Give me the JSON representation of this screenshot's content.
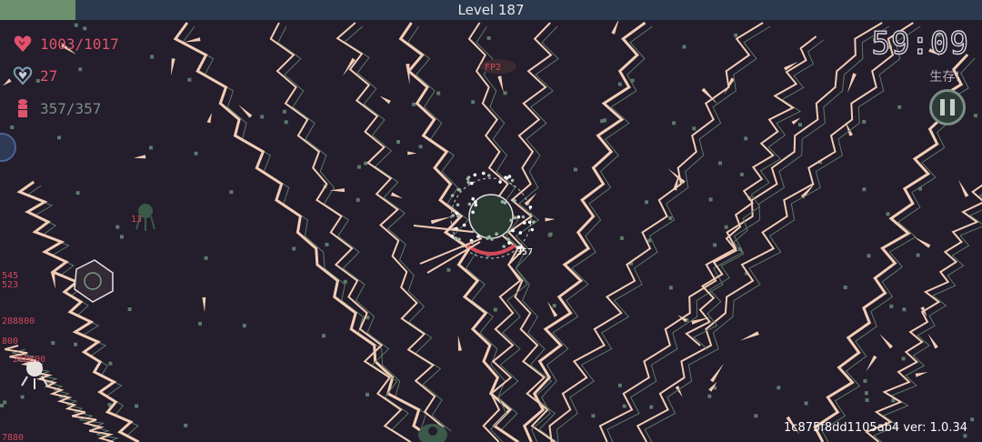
{
  "hud": {
    "level_text": "Level 187",
    "xp_fraction": 0.077,
    "hp_text": "1003/1017",
    "armor_text": "27",
    "ammo_text": "357/357",
    "timer": "59:09",
    "objective": "生存!",
    "version": "1c875f8dd1105ab4 ver: 1.0.34"
  },
  "icons": {
    "hp": "heart-icon",
    "armor": "shield-heart-icon",
    "ammo": "bullet-icon",
    "pause": "pause-icon",
    "ability": "ability-orb-icon"
  },
  "colors": {
    "background": "#231d2c",
    "lightning": "#f2cdb5",
    "hp_red": "#e0546c",
    "ammo_gray": "#7b8f84",
    "xp_bar": "#2b3a4e",
    "xp_fill": "#6c8f6c"
  },
  "floating_text": {
    "player_ammo": "357",
    "enemy_tag": "FP2",
    "left_damage": "13",
    "edge_numbers": [
      "545",
      "523",
      "288800",
      "800",
      "288800",
      "7880"
    ]
  }
}
